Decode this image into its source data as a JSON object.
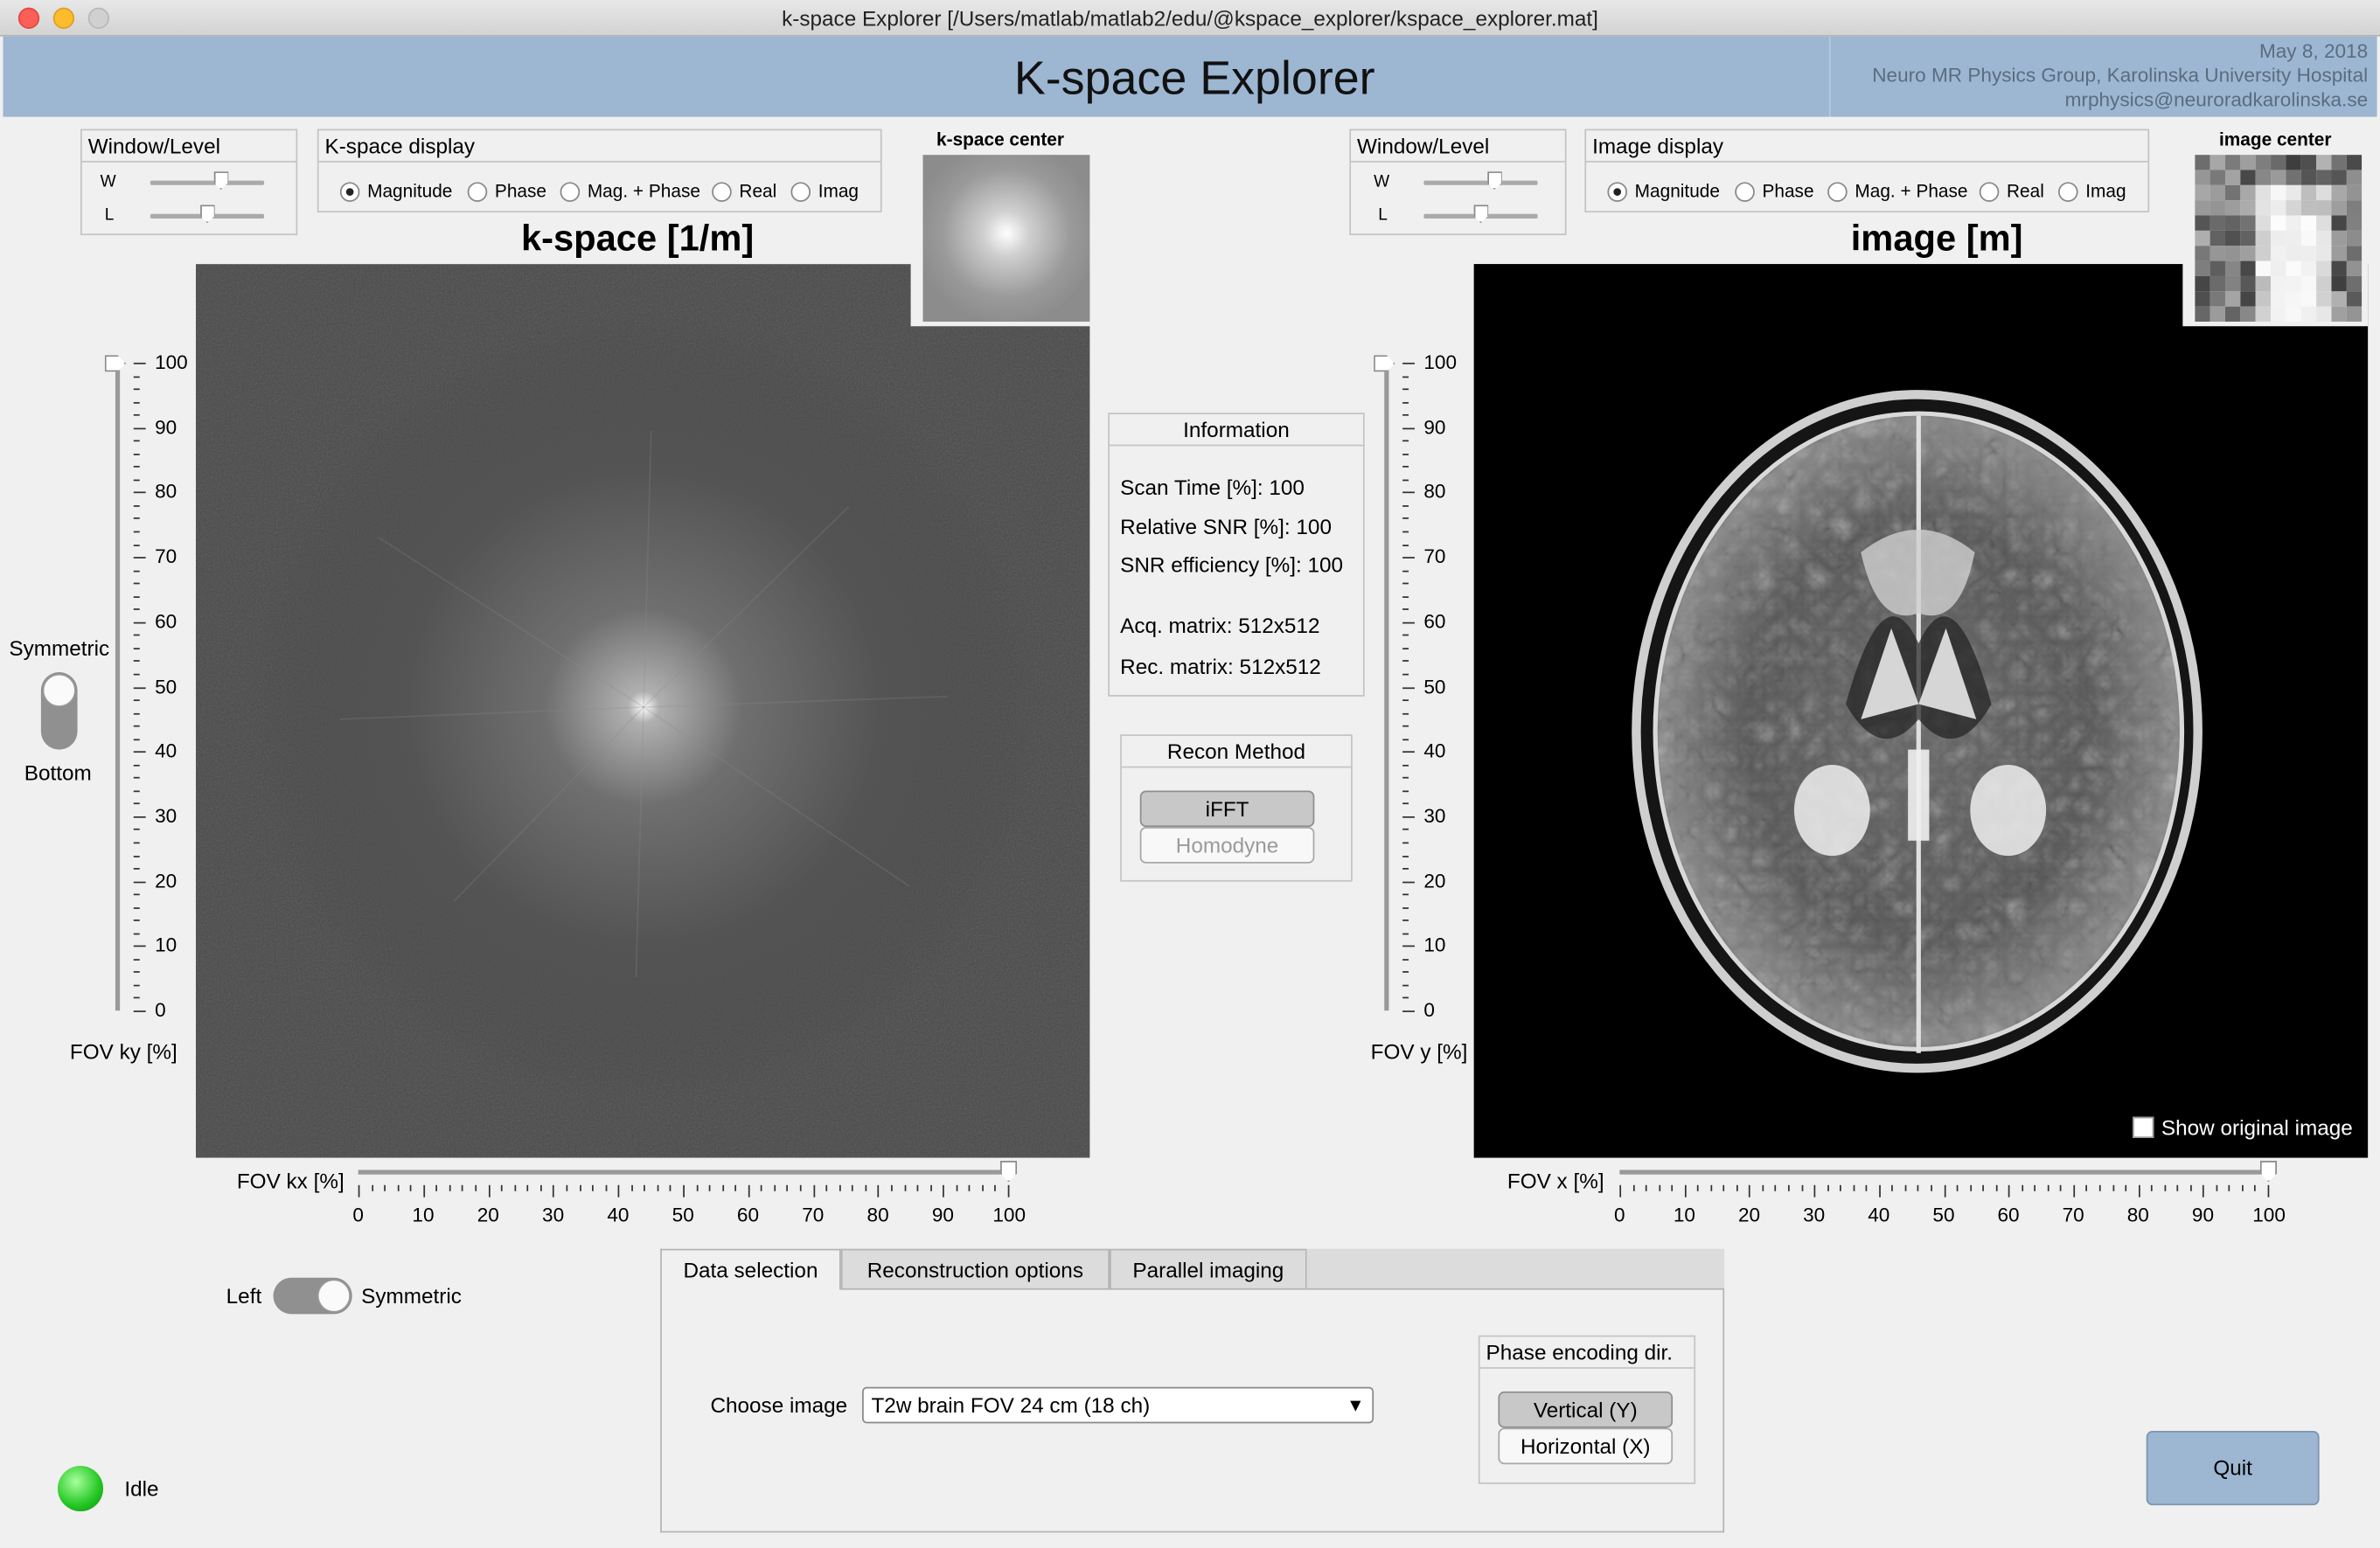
{
  "window": {
    "title": "k-space Explorer [/Users/matlab/matlab2/edu/@kspace_explorer/kspace_explorer.mat]",
    "app_title": "K-space Explorer",
    "credits": [
      "May 8, 2018",
      "Neuro MR Physics Group, Karolinska University Hospital",
      "mrphysics@neuroradkarolinska.se"
    ]
  },
  "left": {
    "wl": {
      "title": "Window/Level",
      "w_label": "W",
      "l_label": "L",
      "w_level": 0.62,
      "l_level": 0.5
    },
    "display": {
      "title": "K-space display",
      "options": [
        "Magnitude",
        "Phase",
        "Mag. + Phase",
        "Real",
        "Imag"
      ],
      "selected": "Magnitude"
    },
    "center_title": "k-space center",
    "plot_title": "k-space [1/m]",
    "vruler": {
      "ticks": [
        "100",
        "90",
        "80",
        "70",
        "60",
        "50",
        "40",
        "30",
        "20",
        "10",
        "0"
      ],
      "label": "FOV ky [%]",
      "value": 100
    },
    "hruler": {
      "ticks": [
        "0",
        "10",
        "20",
        "30",
        "40",
        "50",
        "60",
        "70",
        "80",
        "90",
        "100"
      ],
      "label": "FOV kx [%]",
      "value": 100
    },
    "vtoggle": {
      "top": "Symmetric",
      "bottom": "Bottom"
    },
    "htoggle": {
      "left": "Left",
      "right": "Symmetric"
    }
  },
  "right": {
    "wl": {
      "title": "Window/Level",
      "w_label": "W",
      "l_label": "L",
      "w_level": 0.62,
      "l_level": 0.5
    },
    "display": {
      "title": "Image display",
      "options": [
        "Magnitude",
        "Phase",
        "Mag. + Phase",
        "Real",
        "Imag"
      ],
      "selected": "Magnitude"
    },
    "center_title": "image center",
    "plot_title": "image [m]",
    "vruler": {
      "ticks": [
        "100",
        "90",
        "80",
        "70",
        "60",
        "50",
        "40",
        "30",
        "20",
        "10",
        "0"
      ],
      "label": "FOV y [%]",
      "value": 100
    },
    "hruler": {
      "ticks": [
        "0",
        "10",
        "20",
        "30",
        "40",
        "50",
        "60",
        "70",
        "80",
        "90",
        "100"
      ],
      "label": "FOV x [%]",
      "value": 100
    },
    "show_original": "Show original image"
  },
  "info": {
    "title": "Information",
    "lines": [
      "Scan Time [%]:  100",
      "Relative SNR [%]: 100",
      "SNR efficiency [%]: 100",
      "Acq. matrix: 512x512",
      "Rec. matrix: 512x512"
    ]
  },
  "recon": {
    "title": "Recon Method",
    "ifft": "iFFT",
    "homodyne": "Homodyne"
  },
  "tabs": [
    "Data selection",
    "Reconstruction options",
    "Parallel imaging"
  ],
  "data_selection": {
    "choose_label": "Choose image",
    "choose_value": "T2w brain FOV 24 cm (18 ch)",
    "phase_title": "Phase encoding dir.",
    "vertical": "Vertical (Y)",
    "horizontal": "Horizontal (X)"
  },
  "status": {
    "text": "Idle",
    "color": "#22c622"
  },
  "quit": "Quit"
}
